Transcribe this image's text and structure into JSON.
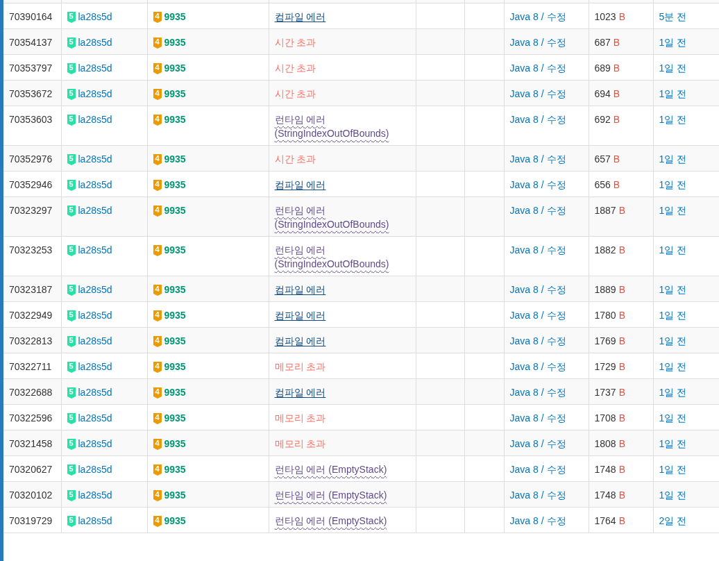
{
  "separator": "/",
  "rows": [
    {
      "id": "70390164",
      "user": "la28s5d",
      "user_tier": "5",
      "problem_tier": "4",
      "problem": "9935",
      "result": {
        "text": "컴파일 에러",
        "kind": "compile"
      },
      "language": "Java 8",
      "edit": "수정",
      "length": "1023",
      "unit": "B",
      "submitted": "5분 전"
    },
    {
      "id": "70354137",
      "user": "la28s5d",
      "user_tier": "5",
      "problem_tier": "4",
      "problem": "9935",
      "result": {
        "text": "시간 초과",
        "kind": "tle"
      },
      "language": "Java 8",
      "edit": "수정",
      "length": "687",
      "unit": "B",
      "submitted": "1일 전"
    },
    {
      "id": "70353797",
      "user": "la28s5d",
      "user_tier": "5",
      "problem_tier": "4",
      "problem": "9935",
      "result": {
        "text": "시간 초과",
        "kind": "tle"
      },
      "language": "Java 8",
      "edit": "수정",
      "length": "689",
      "unit": "B",
      "submitted": "1일 전"
    },
    {
      "id": "70353672",
      "user": "la28s5d",
      "user_tier": "5",
      "problem_tier": "4",
      "problem": "9935",
      "result": {
        "text": "시간 초과",
        "kind": "tle"
      },
      "language": "Java 8",
      "edit": "수정",
      "length": "694",
      "unit": "B",
      "submitted": "1일 전"
    },
    {
      "id": "70353603",
      "user": "la28s5d",
      "user_tier": "5",
      "problem_tier": "4",
      "problem": "9935",
      "result": {
        "text": "런타임 에러 (StringIndexOutOfBounds)",
        "kind": "runtime"
      },
      "language": "Java 8",
      "edit": "수정",
      "length": "692",
      "unit": "B",
      "submitted": "1일 전"
    },
    {
      "id": "70352976",
      "user": "la28s5d",
      "user_tier": "5",
      "problem_tier": "4",
      "problem": "9935",
      "result": {
        "text": "시간 초과",
        "kind": "tle"
      },
      "language": "Java 8",
      "edit": "수정",
      "length": "657",
      "unit": "B",
      "submitted": "1일 전"
    },
    {
      "id": "70352946",
      "user": "la28s5d",
      "user_tier": "5",
      "problem_tier": "4",
      "problem": "9935",
      "result": {
        "text": "컴파일 에러",
        "kind": "compile"
      },
      "language": "Java 8",
      "edit": "수정",
      "length": "656",
      "unit": "B",
      "submitted": "1일 전"
    },
    {
      "id": "70323297",
      "user": "la28s5d",
      "user_tier": "5",
      "problem_tier": "4",
      "problem": "9935",
      "result": {
        "text": "런타임 에러 (StringIndexOutOfBounds)",
        "kind": "runtime"
      },
      "language": "Java 8",
      "edit": "수정",
      "length": "1887",
      "unit": "B",
      "submitted": "1일 전"
    },
    {
      "id": "70323253",
      "user": "la28s5d",
      "user_tier": "5",
      "problem_tier": "4",
      "problem": "9935",
      "result": {
        "text": "런타임 에러 (StringIndexOutOfBounds)",
        "kind": "runtime"
      },
      "language": "Java 8",
      "edit": "수정",
      "length": "1882",
      "unit": "B",
      "submitted": "1일 전"
    },
    {
      "id": "70323187",
      "user": "la28s5d",
      "user_tier": "5",
      "problem_tier": "4",
      "problem": "9935",
      "result": {
        "text": "컴파일 에러",
        "kind": "compile"
      },
      "language": "Java 8",
      "edit": "수정",
      "length": "1889",
      "unit": "B",
      "submitted": "1일 전"
    },
    {
      "id": "70322949",
      "user": "la28s5d",
      "user_tier": "5",
      "problem_tier": "4",
      "problem": "9935",
      "result": {
        "text": "컴파일 에러",
        "kind": "compile"
      },
      "language": "Java 8",
      "edit": "수정",
      "length": "1780",
      "unit": "B",
      "submitted": "1일 전"
    },
    {
      "id": "70322813",
      "user": "la28s5d",
      "user_tier": "5",
      "problem_tier": "4",
      "problem": "9935",
      "result": {
        "text": "컴파일 에러",
        "kind": "compile"
      },
      "language": "Java 8",
      "edit": "수정",
      "length": "1769",
      "unit": "B",
      "submitted": "1일 전"
    },
    {
      "id": "70322711",
      "user": "la28s5d",
      "user_tier": "5",
      "problem_tier": "4",
      "problem": "9935",
      "result": {
        "text": "메모리 초과",
        "kind": "mle"
      },
      "language": "Java 8",
      "edit": "수정",
      "length": "1729",
      "unit": "B",
      "submitted": "1일 전"
    },
    {
      "id": "70322688",
      "user": "la28s5d",
      "user_tier": "5",
      "problem_tier": "4",
      "problem": "9935",
      "result": {
        "text": "컴파일 에러",
        "kind": "compile"
      },
      "language": "Java 8",
      "edit": "수정",
      "length": "1737",
      "unit": "B",
      "submitted": "1일 전"
    },
    {
      "id": "70322596",
      "user": "la28s5d",
      "user_tier": "5",
      "problem_tier": "4",
      "problem": "9935",
      "result": {
        "text": "메모리 초과",
        "kind": "mle"
      },
      "language": "Java 8",
      "edit": "수정",
      "length": "1708",
      "unit": "B",
      "submitted": "1일 전"
    },
    {
      "id": "70321458",
      "user": "la28s5d",
      "user_tier": "5",
      "problem_tier": "4",
      "problem": "9935",
      "result": {
        "text": "메모리 초과",
        "kind": "mle"
      },
      "language": "Java 8",
      "edit": "수정",
      "length": "1808",
      "unit": "B",
      "submitted": "1일 전"
    },
    {
      "id": "70320627",
      "user": "la28s5d",
      "user_tier": "5",
      "problem_tier": "4",
      "problem": "9935",
      "result": {
        "text": "런타임 에러 (EmptyStack)",
        "kind": "runtime"
      },
      "language": "Java 8",
      "edit": "수정",
      "length": "1748",
      "unit": "B",
      "submitted": "1일 전"
    },
    {
      "id": "70320102",
      "user": "la28s5d",
      "user_tier": "5",
      "problem_tier": "4",
      "problem": "9935",
      "result": {
        "text": "런타임 에러 (EmptyStack)",
        "kind": "runtime"
      },
      "language": "Java 8",
      "edit": "수정",
      "length": "1748",
      "unit": "B",
      "submitted": "1일 전"
    },
    {
      "id": "70319729",
      "user": "la28s5d",
      "user_tier": "5",
      "problem_tier": "4",
      "problem": "9935",
      "result": {
        "text": "런타임 에러 (EmptyStack)",
        "kind": "runtime"
      },
      "language": "Java 8",
      "edit": "수정",
      "length": "1764",
      "unit": "B",
      "submitted": "2일 전"
    }
  ]
}
